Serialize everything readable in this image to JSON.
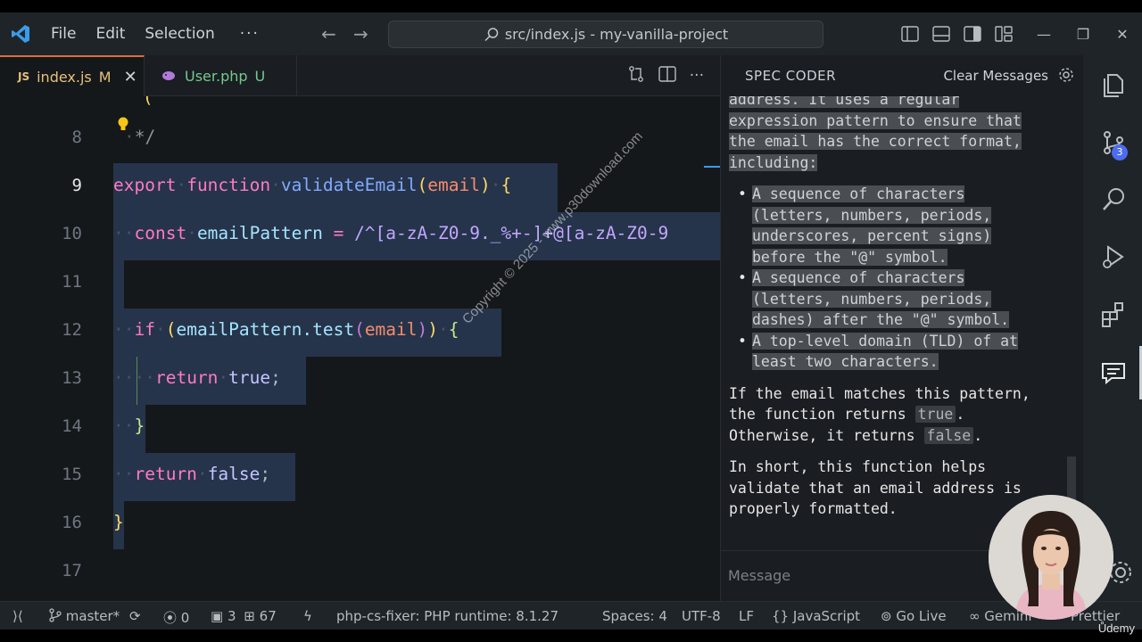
{
  "titlebar": {
    "menu": [
      "File",
      "Edit",
      "Selection"
    ],
    "more": "···",
    "search_text": "src/index.js - my-vanilla-project"
  },
  "tabs": [
    {
      "badge": "JS",
      "name": "index.js",
      "status": "M",
      "close": "✕"
    },
    {
      "name": "User.php",
      "status": "U"
    }
  ],
  "editor": {
    "lines": [
      {
        "num": "8",
        "text": "*/"
      },
      {
        "num": "9",
        "kw": "export",
        "kw2": "function",
        "fn": "validateEmail",
        "param": "email"
      },
      {
        "num": "10",
        "kw": "const",
        "var": "emailPattern",
        "op": " = ",
        "regex": "/^[a-zA-Z0-9._%+-]+@[a-zA-Z0-9"
      },
      {
        "num": "11"
      },
      {
        "num": "12",
        "kw": "if",
        "var": "emailPattern",
        "method": ".test",
        "param": "email"
      },
      {
        "num": "13",
        "kw": "return",
        "value": "true",
        "end": ";"
      },
      {
        "num": "14",
        "text": "}"
      },
      {
        "num": "15",
        "kw": "return",
        "value": "false",
        "end": ";"
      },
      {
        "num": "16",
        "text": "}"
      },
      {
        "num": "17"
      }
    ],
    "watermark": "Copyright © 2025 - www.p30download.com"
  },
  "panel": {
    "title": "SPEC CODER",
    "clear_label": "Clear Messages",
    "intro_1": "address. It uses a regular",
    "intro_2": "expression pattern to ensure that",
    "intro_3": "the email has the correct format,",
    "intro_4": "including:",
    "bullets": [
      [
        "A sequence of characters",
        "(letters, numbers, periods,",
        "underscores, percent signs)",
        "before the \"@\" symbol."
      ],
      [
        "A sequence of characters",
        "(letters, numbers, periods,",
        "dashes) after the \"@\" symbol."
      ],
      [
        "A top-level domain (TLD) of at",
        "least two characters."
      ]
    ],
    "para2_a": "If the email matches this pattern,",
    "para2_b": "the function returns ",
    "para2_true": "true",
    "para2_c": ".",
    "para2_d": "Otherwise, it returns ",
    "para2_false": "false",
    "para2_e": ".",
    "para3_a": "In short, this function helps",
    "para3_b": "validate that an email address is",
    "para3_c": "properly formatted.",
    "message_placeholder": "Message"
  },
  "activity": {
    "badge": "3"
  },
  "status": {
    "branch": "master*",
    "ports": "0",
    "problems_a": "3",
    "problems_b": "67",
    "php": "php-cs-fixer: PHP runtime: 8.1.27",
    "spaces": "Spaces: 4",
    "encoding": "UTF-8",
    "eol": "LF",
    "language": "{} JavaScript",
    "golive": "Go Live",
    "gemini": "Gemini",
    "prettier": "Prettier"
  },
  "udemy": "Ůdemy",
  "colors": {
    "accent": "#e06c3c",
    "selection": "#25344a",
    "badge": "#4d6cf0"
  }
}
